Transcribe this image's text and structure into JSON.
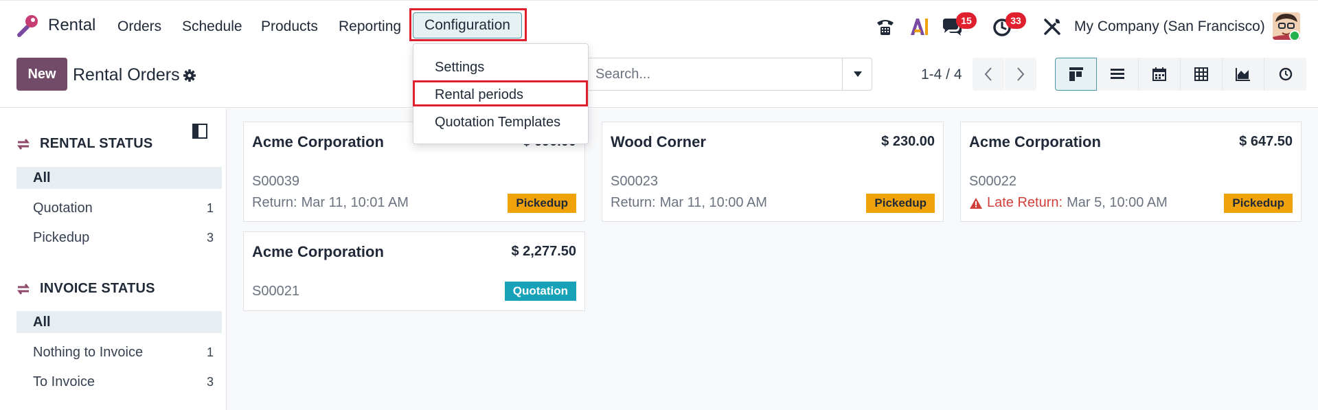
{
  "navbar": {
    "app_name": "Rental",
    "menu": [
      "Orders",
      "Schedule",
      "Products",
      "Reporting"
    ],
    "active_menu": "Configuration",
    "messages_badge": "15",
    "activities_badge": "33",
    "company": "My Company (San Francisco)",
    "icons": [
      "phone-icon",
      "ai-icon",
      "chat-icon",
      "clock-icon",
      "tools-icon"
    ]
  },
  "control_panel": {
    "new_label": "New",
    "title": "Rental Orders",
    "search_placeholder": "Search...",
    "pager": "1-4 / 4",
    "views": [
      "kanban-view-icon",
      "list-view-icon",
      "calendar-view-icon",
      "pivot-view-icon",
      "graph-view-icon",
      "activity-view-icon"
    ]
  },
  "dropdown": {
    "items": [
      "Settings",
      "Rental periods",
      "Quotation Templates"
    ],
    "highlighted": "Rental periods"
  },
  "sidebar": {
    "rental_status": {
      "title": "RENTAL STATUS",
      "items": [
        {
          "label": "All",
          "count": ""
        },
        {
          "label": "Quotation",
          "count": "1"
        },
        {
          "label": "Pickedup",
          "count": "3"
        }
      ]
    },
    "invoice_status": {
      "title": "INVOICE STATUS",
      "items": [
        {
          "label": "All",
          "count": ""
        },
        {
          "label": "Nothing to Invoice",
          "count": "1"
        },
        {
          "label": "To Invoice",
          "count": "3"
        }
      ]
    }
  },
  "cards": [
    {
      "customer": "Acme Corporation",
      "amount": "$ 690.00",
      "ref": "S00039",
      "return_label": "Return:",
      "return_date": "Mar 11, 10:01 AM",
      "tag": "Pickedup"
    },
    {
      "customer": "Wood Corner",
      "amount": "$ 230.00",
      "ref": "S00023",
      "return_label": "Return:",
      "return_date": "Mar 11, 10:00 AM",
      "tag": "Pickedup"
    },
    {
      "customer": "Acme Corporation",
      "amount": "$ 647.50",
      "ref": "S00022",
      "return_label": "Late Return:",
      "return_date": "Mar 5, 10:00 AM",
      "tag": "Pickedup"
    },
    {
      "customer": "Acme Corporation",
      "amount": "$ 2,277.50",
      "ref": "S00021",
      "return_label": "",
      "return_date": "",
      "tag": "Quotation"
    }
  ],
  "colors": {
    "brand": "#714b67",
    "accent": "#4a98a6",
    "badge": "#e0202e",
    "pickedup": "#f0a20a",
    "quotation": "#17a2b8",
    "late": "#d23f3a"
  }
}
